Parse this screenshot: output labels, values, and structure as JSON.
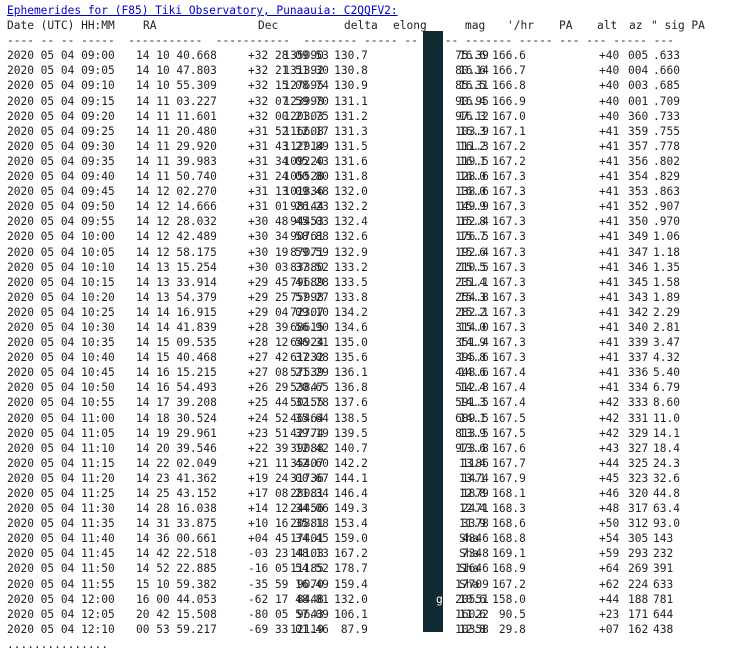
{
  "title": "Ephemerides for (F85) Tiki Observatory, Punaauia: C2QQFV2:",
  "header": {
    "date": "Date (UTC) HH:MM",
    "ra": "RA",
    "dec": "Dec",
    "delta": "delta",
    "elong": "elong",
    "sm": "SM",
    "mag": "mag",
    "rate": "'/hr",
    "pa": "PA",
    "alt": "alt",
    "az": "az",
    "sigpa": "\" sig PA"
  },
  "separator": "---- -- -- -----  -----------  -----------  -------- ----- --  ---- ------- ----- --- --- ----- ---",
  "rows": [
    [
      "2020 05 04 09:00",
      "14 10 40.668",
      "+32 28 09.53",
      "135090",
      "130.7",
      "M",
      "16.6",
      "75.39",
      "166.6",
      "+40",
      "005",
      ".633"
    ],
    [
      "2020 05 04 09:05",
      "14 10 47.803",
      "+32 21 51.30",
      "131392",
      "130.8",
      "M",
      "16.6",
      "80.14",
      "166.7",
      "+40",
      "004",
      ".660"
    ],
    [
      "2020 05 04 09:10",
      "14 10 55.309",
      "+32 15 08.74",
      "127695",
      "130.9",
      "M",
      "16.5",
      "85.31",
      "166.8",
      "+40",
      "003",
      ".685"
    ],
    [
      "2020 05 04 09:15",
      "14 11 03.227",
      "+32 07 59.70",
      "123998",
      "131.1",
      "M",
      "16.4",
      "90.95",
      "166.9",
      "+40",
      "001",
      ".709"
    ],
    [
      "2020 05 04 09:20",
      "14 11 11.601",
      "+32 00 21.75",
      "120303",
      "131.2",
      "M",
      "16.3",
      "97.12",
      "167.0",
      "+40",
      "360",
      ".733"
    ],
    [
      "2020 05 04 09:25",
      "14 11 20.480",
      "+31 52 12.17",
      "116608",
      "131.3",
      "M",
      "16.3",
      "103.9",
      "167.1",
      "+41",
      "359",
      ".755"
    ],
    [
      "2020 05 04 09:30",
      "14 11 29.920",
      "+31 43 27.89",
      "112914",
      "131.5",
      "M",
      "16.2",
      "111.3",
      "167.2",
      "+41",
      "357",
      ".778"
    ],
    [
      "2020 05 04 09:35",
      "14 11 39.983",
      "+31 34 05.43",
      "109220",
      "131.6",
      "M",
      "16.1",
      "119.5",
      "167.2",
      "+41",
      "356",
      ".802"
    ],
    [
      "2020 05 04 09:40",
      "14 11 50.740",
      "+31 24 00.80",
      "105528",
      "131.8",
      "M",
      "16.0",
      "128.6",
      "167.3",
      "+41",
      "354",
      ".829"
    ],
    [
      "2020 05 04 09:45",
      "14 12 02.270",
      "+31 13 09.48",
      "101836",
      "132.0",
      "M",
      "16.0",
      "138.6",
      "167.3",
      "+41",
      "353",
      ".863"
    ],
    [
      "2020 05 04 09:50",
      "14 12 14.666",
      "+31 01 26.23",
      "98144",
      "132.2",
      "M",
      "15.9",
      "149.9",
      "167.3",
      "+41",
      "352",
      ".907"
    ],
    [
      "2020 05 04 09:55",
      "14 12 28.032",
      "+30 48 45.03",
      "94453",
      "132.4",
      "M",
      "15.8",
      "162.4",
      "167.3",
      "+41",
      "350",
      ".970"
    ],
    [
      "2020 05 04 10:00",
      "14 12 42.489",
      "+30 34 58.88",
      "90761",
      "132.6",
      "M",
      "15.7",
      "176.5",
      "167.3",
      "+41",
      "349",
      "1.06"
    ],
    [
      "2020 05 04 10:05",
      "14 12 58.175",
      "+30 19 59.59",
      "87071",
      "132.9",
      "M",
      "15.6",
      "192.4",
      "167.3",
      "+41",
      "347",
      "1.18"
    ],
    [
      "2020 05 04 10:10",
      "14 13 15.254",
      "+30 03 37.52",
      "83380",
      "133.2",
      "M",
      "15.5",
      "210.5",
      "167.3",
      "+41",
      "346",
      "1.35"
    ],
    [
      "2020 05 04 10:15",
      "14 13 33.914",
      "+29 45 41.28",
      "79689",
      "133.5",
      "M",
      "15.4",
      "231.1",
      "167.3",
      "+41",
      "345",
      "1.58"
    ],
    [
      "2020 05 04 10:20",
      "14 13 54.379",
      "+29 25 57.27",
      "75998",
      "133.8",
      "M",
      "15.3",
      "254.8",
      "167.3",
      "+41",
      "343",
      "1.89"
    ],
    [
      "2020 05 04 10:25",
      "14 14 16.915",
      "+29 04 09.10",
      "72307",
      "134.2",
      "M",
      "15.2",
      "282.1",
      "167.3",
      "+41",
      "342",
      "2.29"
    ],
    [
      "2020 05 04 10:30",
      "14 14 41.839",
      "+28 39 56.90",
      "68615",
      "134.6",
      "M",
      "15.0",
      "314.0",
      "167.3",
      "+41",
      "340",
      "2.81"
    ],
    [
      "2020 05 04 10:35",
      "14 15 09.535",
      "+28 12 56.31",
      "64924",
      "135.0",
      "M",
      "14.9",
      "351.4",
      "167.3",
      "+41",
      "339",
      "3.47"
    ],
    [
      "2020 05 04 10:40",
      "14 15 40.468",
      "+27 42 37.08",
      "61232",
      "135.6",
      "M",
      "14.8",
      "395.6",
      "167.3",
      "+41",
      "337",
      "4.32"
    ],
    [
      "2020 05 04 10:45",
      "14 16 15.215",
      "+27 08 21.29",
      "57539",
      "136.1",
      "M",
      "14.6",
      "448.6",
      "167.4",
      "+41",
      "336",
      "5.40"
    ],
    [
      "2020 05 04 10:50",
      "14 16 54.493",
      "+26 29 20.65",
      "53847",
      "136.8",
      "M",
      "14.4",
      "512.8",
      "167.4",
      "+41",
      "334",
      "6.79"
    ],
    [
      "2020 05 04 10:55",
      "14 17 39.208",
      "+25 44 32.78",
      "50155",
      "137.6",
      "M",
      "14.3",
      "591.5",
      "167.4",
      "+42",
      "333",
      "8.60"
    ],
    [
      "2020 05 04 11:00",
      "14 18 30.524",
      "+24 52 35.64",
      "46464",
      "138.5",
      "M",
      "14.1",
      "689.5",
      "167.5",
      "+42",
      "331",
      "11.0"
    ],
    [
      "2020 05 04 11:05",
      "14 19 29.961",
      "+23 51 39.19",
      "42774",
      "139.5",
      "M",
      "13.9",
      "813.5",
      "167.5",
      "+42",
      "329",
      "14.1"
    ],
    [
      "2020 05 04 11:10",
      "14 20 39.546",
      "+22 39 12.42",
      "39088",
      "140.7",
      "M",
      "13.6",
      "973.8",
      "167.6",
      "+43",
      "327",
      "18.4"
    ],
    [
      "2020 05 04 11:15",
      "14 22 02.049",
      "+21 11 42.60",
      "35407",
      "142.2",
      "M",
      "13.4",
      "1186",
      "167.7",
      "+44",
      "325",
      "24.3"
    ],
    [
      "2020 05 04 11:20",
      "14 23 41.362",
      "+19 24 00.67",
      "31736",
      "144.1",
      "M",
      "13.1",
      "1474",
      "167.9",
      "+45",
      "323",
      "32.6"
    ],
    [
      "2020 05 04 11:25",
      "14 25 43.152",
      "+17 08 21.34",
      "28081",
      "146.4",
      "M",
      "12.8",
      "1879",
      "168.1",
      "+46",
      "320",
      "44.8"
    ],
    [
      "2020 05 04 11:30",
      "14 28 16.038",
      "+14 12 34.06",
      "24456",
      "149.3",
      "M",
      "12.4",
      "2471",
      "168.3",
      "+48",
      "317",
      "63.4"
    ],
    [
      "2020 05 04 11:35",
      "14 31 33.875",
      "+10 16 35.18",
      "20881",
      "153.4",
      "M",
      "11.9",
      "3378",
      "168.6",
      "+50",
      "312",
      "93.0"
    ],
    [
      "2020 05 04 11:40",
      "14 36 00.661",
      "+04 45 34.45",
      "17401",
      "159.0",
      "M",
      "Sha",
      "4846",
      "168.8",
      "+54",
      "305",
      "143"
    ],
    [
      "2020 05 04 11:45",
      "14 42 22.518",
      "-03 23 48.13",
      "14103",
      "167.2",
      "M",
      "Sha",
      "7348",
      "169.1",
      "+59",
      "293",
      "232"
    ],
    [
      "2020 05 04 11:50",
      "14 52 22.885",
      "-16 05 54.52",
      "11185",
      "178.7",
      "M",
      "Sha",
      "11646",
      "168.9",
      "+64",
      "269",
      "391"
    ],
    [
      "2020 05 04 11:55",
      "15 10 59.382",
      "-35 59 16.49",
      "9070",
      "159.4",
      "M",
      "Sha",
      "17709",
      "167.2",
      "+62",
      "224",
      "633"
    ],
    [
      "2020 05 04 12:00",
      "16 00 44.053",
      "-62 17 48.81",
      "8448",
      "132.0",
      "gM",
      "10.6",
      "20551",
      "158.0",
      "+44",
      "188",
      "781"
    ],
    [
      "2020 05 04 12:05",
      "20 42 15.508",
      "-80 05 57.09",
      "9643",
      "106.1",
      "M",
      "11.6",
      "16022",
      "90.5",
      "+23",
      "171",
      "644"
    ],
    [
      "2020 05 04 12:10",
      "00 53 59.217",
      "-69 33 01.46",
      "12119",
      "87.9",
      "M",
      "12.8",
      "10358",
      "29.8",
      "+07",
      "162",
      "438"
    ]
  ],
  "footer_dots": "..............."
}
